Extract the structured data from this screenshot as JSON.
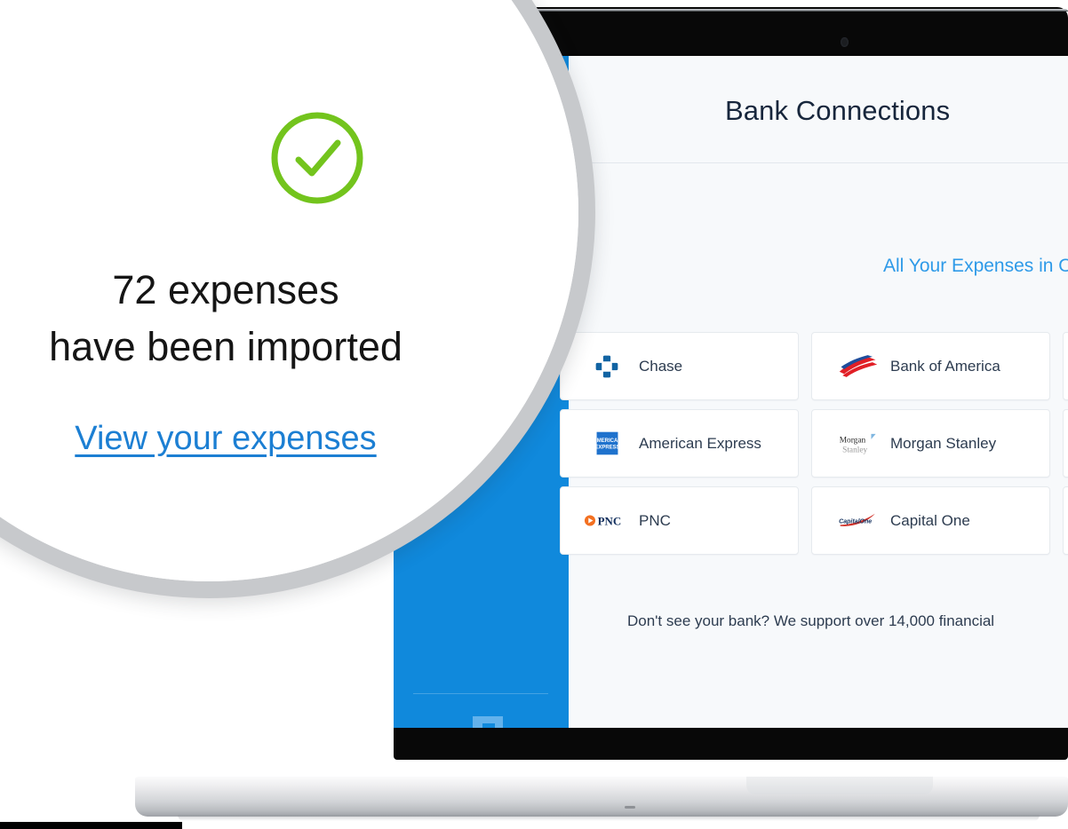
{
  "magnifier": {
    "status_icon": "green-check-circle-icon",
    "status_color": "#73c41d",
    "imported_line_1": "72 expenses",
    "imported_line_2": "have been imported",
    "expense_count": 72,
    "link_label": "View your expenses",
    "link_color": "#1c7fd3"
  },
  "app": {
    "sidebar": {
      "brand_icon": "freshbooks-f-logo-icon",
      "background_color": "#1089dc"
    },
    "header": {
      "title": "Bank Connections",
      "title_color": "#17263c"
    },
    "tagline": "All Your Expenses in One Place for Tax",
    "tagline_color": "#2e9ae8",
    "banks": [
      {
        "name": "Chase",
        "logo": "chase-logo-icon"
      },
      {
        "name": "Bank of America",
        "logo": "bank-of-america-logo-icon"
      },
      {
        "name": "",
        "logo": "wells-fargo-logo-icon"
      },
      {
        "name": "American Express",
        "logo": "american-express-logo-icon"
      },
      {
        "name": "Morgan Stanley",
        "logo": "morgan-stanley-logo-icon"
      },
      {
        "name": "",
        "logo": "us-bank-logo-icon"
      },
      {
        "name": "PNC",
        "logo": "pnc-logo-icon"
      },
      {
        "name": "Capital One",
        "logo": "capital-one-logo-icon"
      },
      {
        "name": "",
        "logo": "hsbc-logo-icon"
      }
    ],
    "support_note": "Don't see your bank? We support over 14,000 financial",
    "supported_institutions": "14,000"
  },
  "device": {
    "type": "laptop",
    "webcam": "webcam-dot-icon"
  }
}
